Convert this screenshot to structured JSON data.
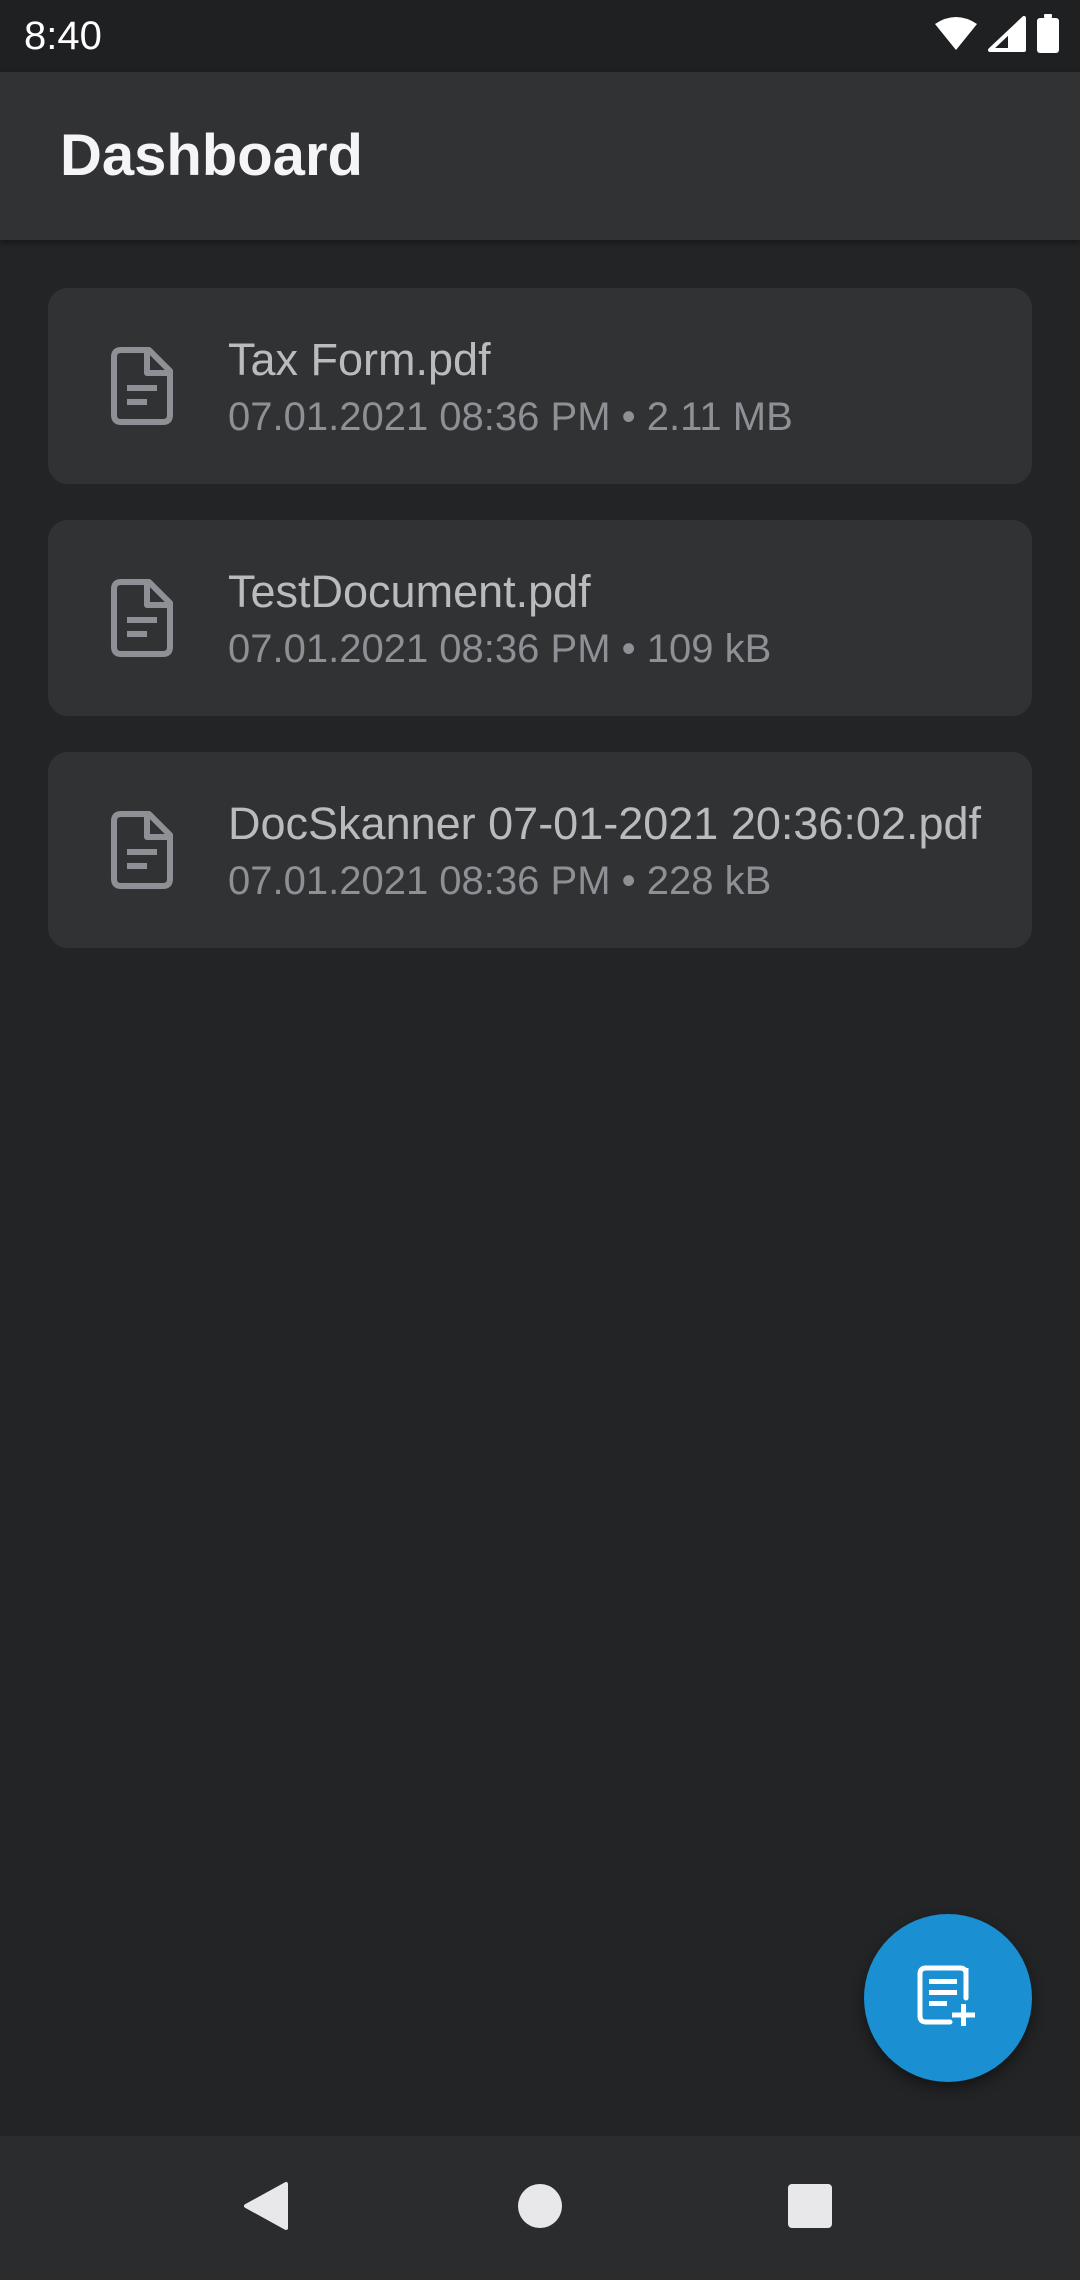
{
  "status_bar": {
    "time": "8:40",
    "icons": [
      "wifi-icon",
      "signal-icon",
      "battery-icon"
    ]
  },
  "app_bar": {
    "title": "Dashboard"
  },
  "files": [
    {
      "name": "Tax Form.pdf",
      "meta": "07.01.2021 08:36 PM • 2.11 MB",
      "icon": "document-icon"
    },
    {
      "name": "TestDocument.pdf",
      "meta": "07.01.2021 08:36 PM • 109 kB",
      "icon": "document-icon"
    },
    {
      "name": "DocSkanner 07-01-2021 20:36:02.pdf",
      "meta": "07.01.2021 08:36 PM • 228 kB",
      "icon": "document-icon"
    }
  ],
  "fab": {
    "icon": "new-document-icon",
    "color": "#1a8fd2"
  },
  "nav_bar": {
    "buttons": [
      "back-icon",
      "home-icon",
      "recents-icon"
    ]
  },
  "colors": {
    "background": "#232426",
    "surface": "#313234",
    "accent": "#1a8fd2"
  }
}
